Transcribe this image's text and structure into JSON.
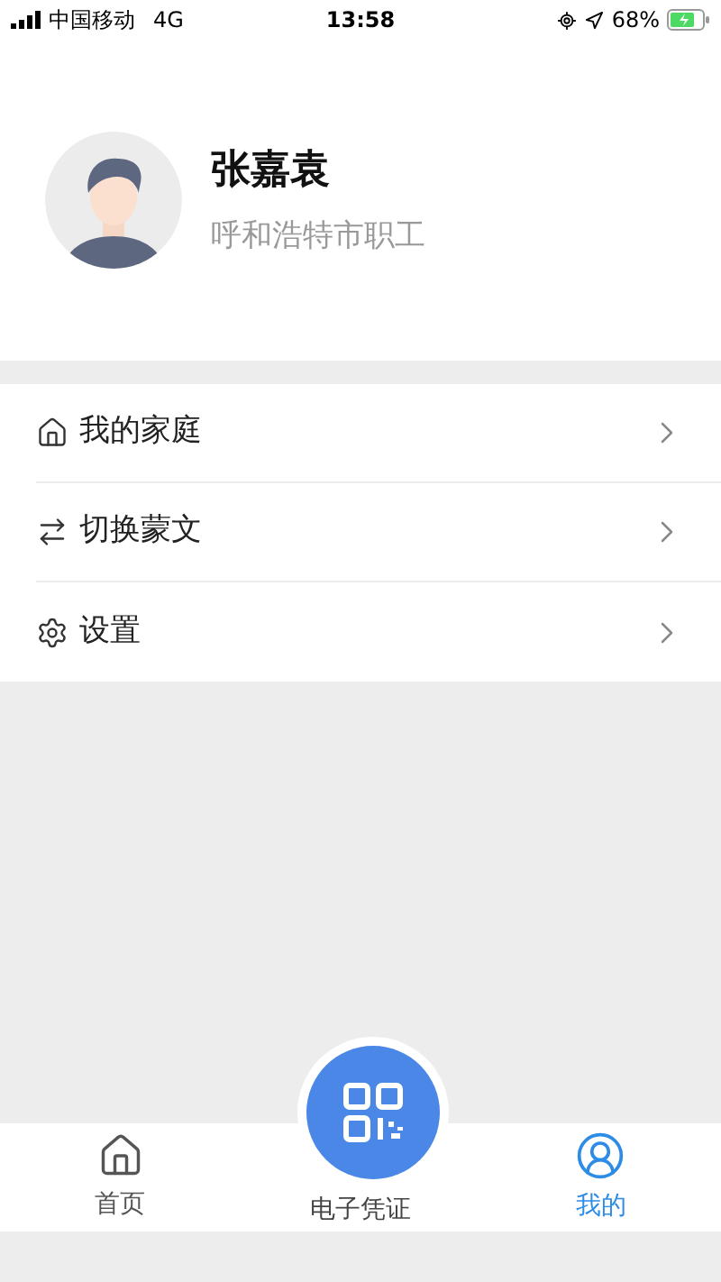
{
  "status_bar": {
    "carrier": "中国移动",
    "network": "4G",
    "time": "13:58",
    "battery": "68%"
  },
  "profile": {
    "name": "张嘉袁",
    "subtitle": "呼和浩特市职工"
  },
  "menu": [
    {
      "kind": "home",
      "label": "我的家庭"
    },
    {
      "kind": "switch",
      "label": "切换蒙文"
    },
    {
      "kind": "settings",
      "label": "设置"
    }
  ],
  "tab_bar": [
    {
      "kind": "home",
      "label": "首页",
      "selected": false
    },
    {
      "kind": "qr",
      "label": "电子凭证",
      "selected": false
    },
    {
      "kind": "user",
      "label": "我的",
      "selected": true
    }
  ]
}
